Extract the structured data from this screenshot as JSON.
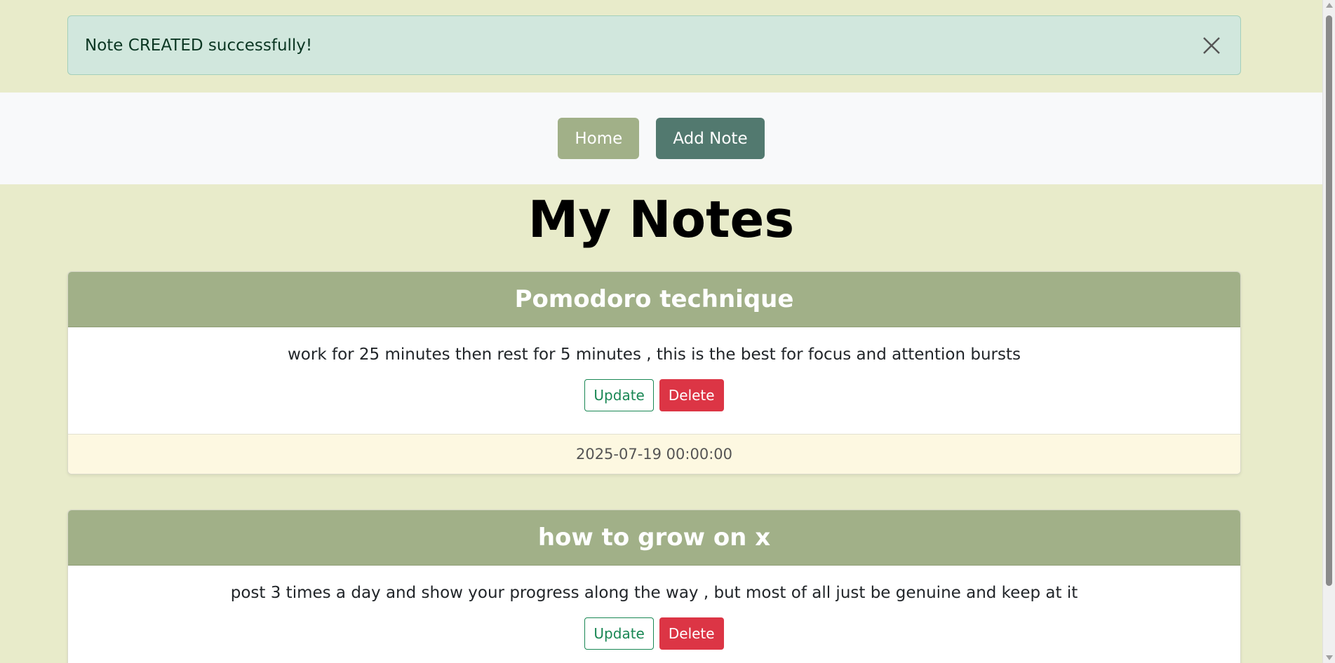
{
  "alert": {
    "message": "Note CREATED successfully!",
    "close_icon": "close-icon"
  },
  "navbar": {
    "home_label": "Home",
    "add_note_label": "Add Note"
  },
  "page": {
    "title": "My Notes"
  },
  "notes": [
    {
      "title": "Pomodoro technique",
      "content": "work for 25 minutes then rest for 5 minutes , this is the best for focus and attention bursts",
      "update_label": "Update",
      "delete_label": "Delete",
      "timestamp": "2025-07-19 00:00:00"
    },
    {
      "title": "how to grow on x",
      "content": "post 3 times a day and show your progress along the way , but most of all just be genuine and keep at it",
      "update_label": "Update",
      "delete_label": "Delete"
    }
  ],
  "colors": {
    "page_bg": "#e8ebca",
    "alert_bg": "#d1e7dd",
    "nav_home": "#a1b088",
    "nav_add": "#52796f",
    "card_header": "#a1b088",
    "update": "#198754",
    "delete": "#dc3545",
    "footer_bg": "#fdf8e1"
  }
}
